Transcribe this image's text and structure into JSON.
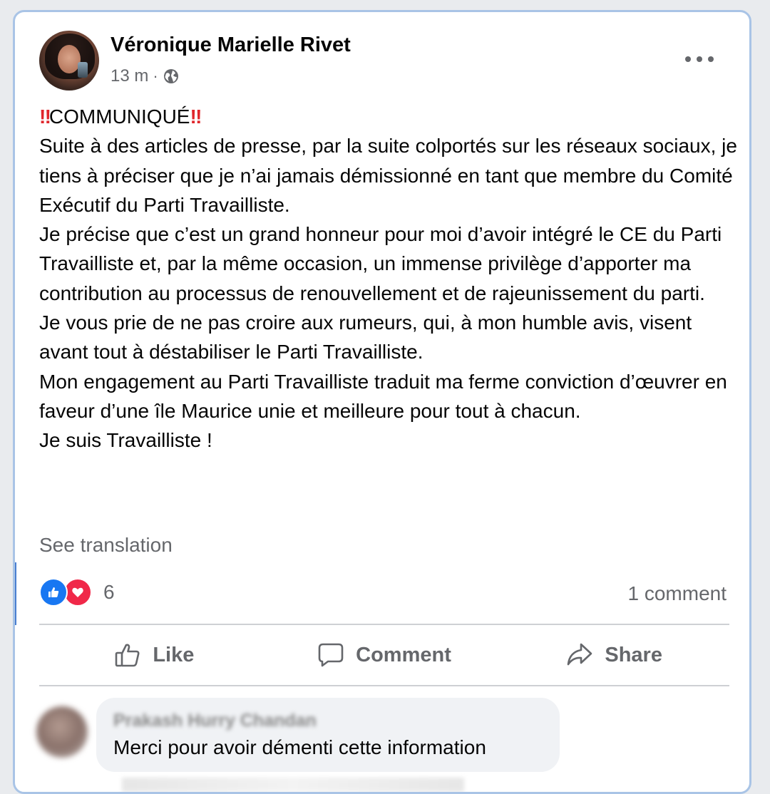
{
  "post": {
    "author": "Véronique Marielle Rivet",
    "time": "13 m",
    "separator": "·",
    "privacy_icon": "globe-icon",
    "more_icon": "more-icon",
    "heading_emoji_left": "‼",
    "heading": "COMMUNIQUÉ",
    "heading_emoji_right": "‼",
    "paragraphs": [
      "Suite à des articles de presse, par la suite colportés sur les réseaux sociaux, je tiens à préciser que je n’ai jamais démissionné en tant que membre du Comité Exécutif du Parti Travailliste.",
      "Je précise que c’est un grand honneur pour moi d’avoir intégré le CE du Parti Travailliste et, par la même occasion, un immense privilège d’apporter ma contribution au processus de renouvellement et de rajeunissement du parti.",
      "Je vous prie de ne pas croire aux rumeurs, qui, à mon humble avis, visent avant tout à déstabiliser le Parti Travailliste.",
      "Mon engagement au Parti Travailliste traduit ma ferme conviction d’œuvrer en faveur d’une île Maurice unie et meilleure pour tout à chacun.",
      "Je suis Travailliste !"
    ],
    "see_translation": "See translation"
  },
  "stats": {
    "reaction_icons": [
      "like-reaction-icon",
      "love-reaction-icon"
    ],
    "reaction_count": "6",
    "comment_count": "1 comment"
  },
  "actions": {
    "like": "Like",
    "comment": "Comment",
    "share": "Share"
  },
  "comments": [
    {
      "name": "Prakash Hurry Chandan",
      "text": "Merci pour avoir démenti cette information"
    }
  ],
  "colors": {
    "like_blue": "#1877f2",
    "love_red": "#f02849",
    "muted_text": "#65676b",
    "alert_red": "#e0262b"
  }
}
